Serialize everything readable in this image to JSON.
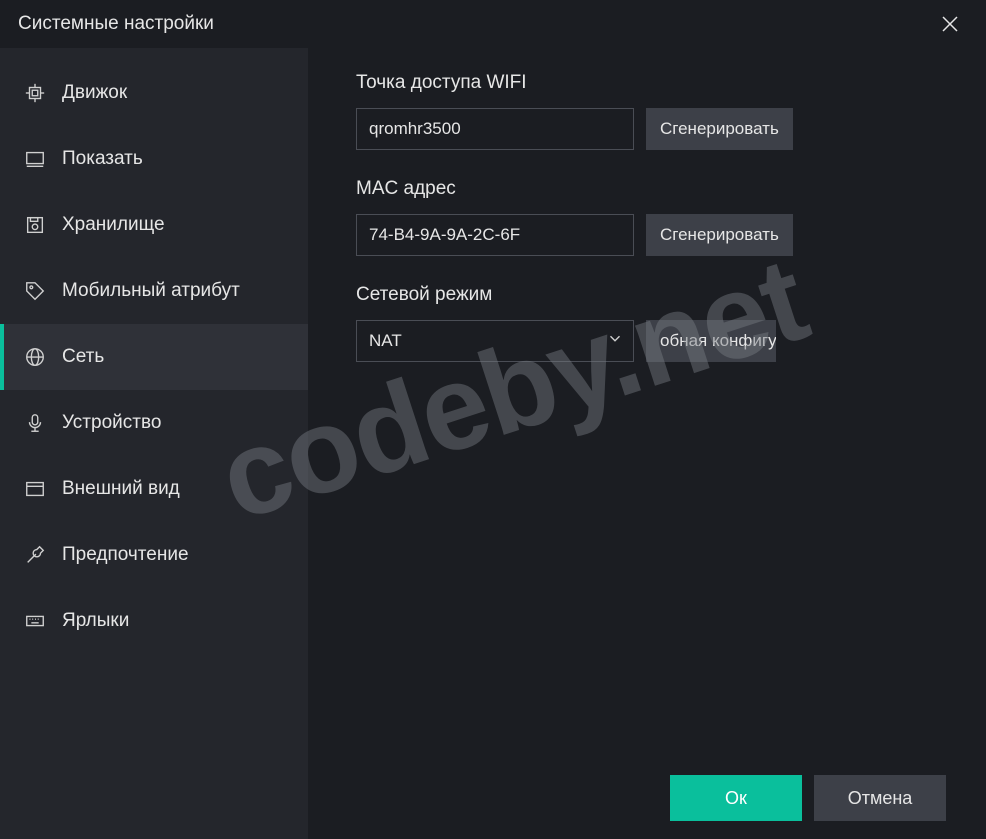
{
  "window": {
    "title": "Системные настройки"
  },
  "sidebar": {
    "items": [
      {
        "label": "Движок",
        "icon": "cpu"
      },
      {
        "label": "Показать",
        "icon": "display"
      },
      {
        "label": "Хранилище",
        "icon": "save"
      },
      {
        "label": "Мобильный атрибут",
        "icon": "tag"
      },
      {
        "label": "Сеть",
        "icon": "globe",
        "active": true
      },
      {
        "label": "Устройство",
        "icon": "mic"
      },
      {
        "label": "Внешний вид",
        "icon": "window"
      },
      {
        "label": "Предпочтение",
        "icon": "wrench"
      },
      {
        "label": "Ярлыки",
        "icon": "keyboard"
      }
    ]
  },
  "network": {
    "wifi_label": "Точка доступа WIFI",
    "wifi_value": "qromhr3500",
    "wifi_generate": "Сгенерировать",
    "mac_label": "MAC адрес",
    "mac_value": "74-B4-9A-9A-2C-6F",
    "mac_generate": "Сгенерировать",
    "mode_label": "Сетевой режим",
    "mode_value": "NAT",
    "mode_config": "обная конфигур"
  },
  "footer": {
    "ok": "Ок",
    "cancel": "Отмена"
  },
  "watermark": "codeby.net"
}
